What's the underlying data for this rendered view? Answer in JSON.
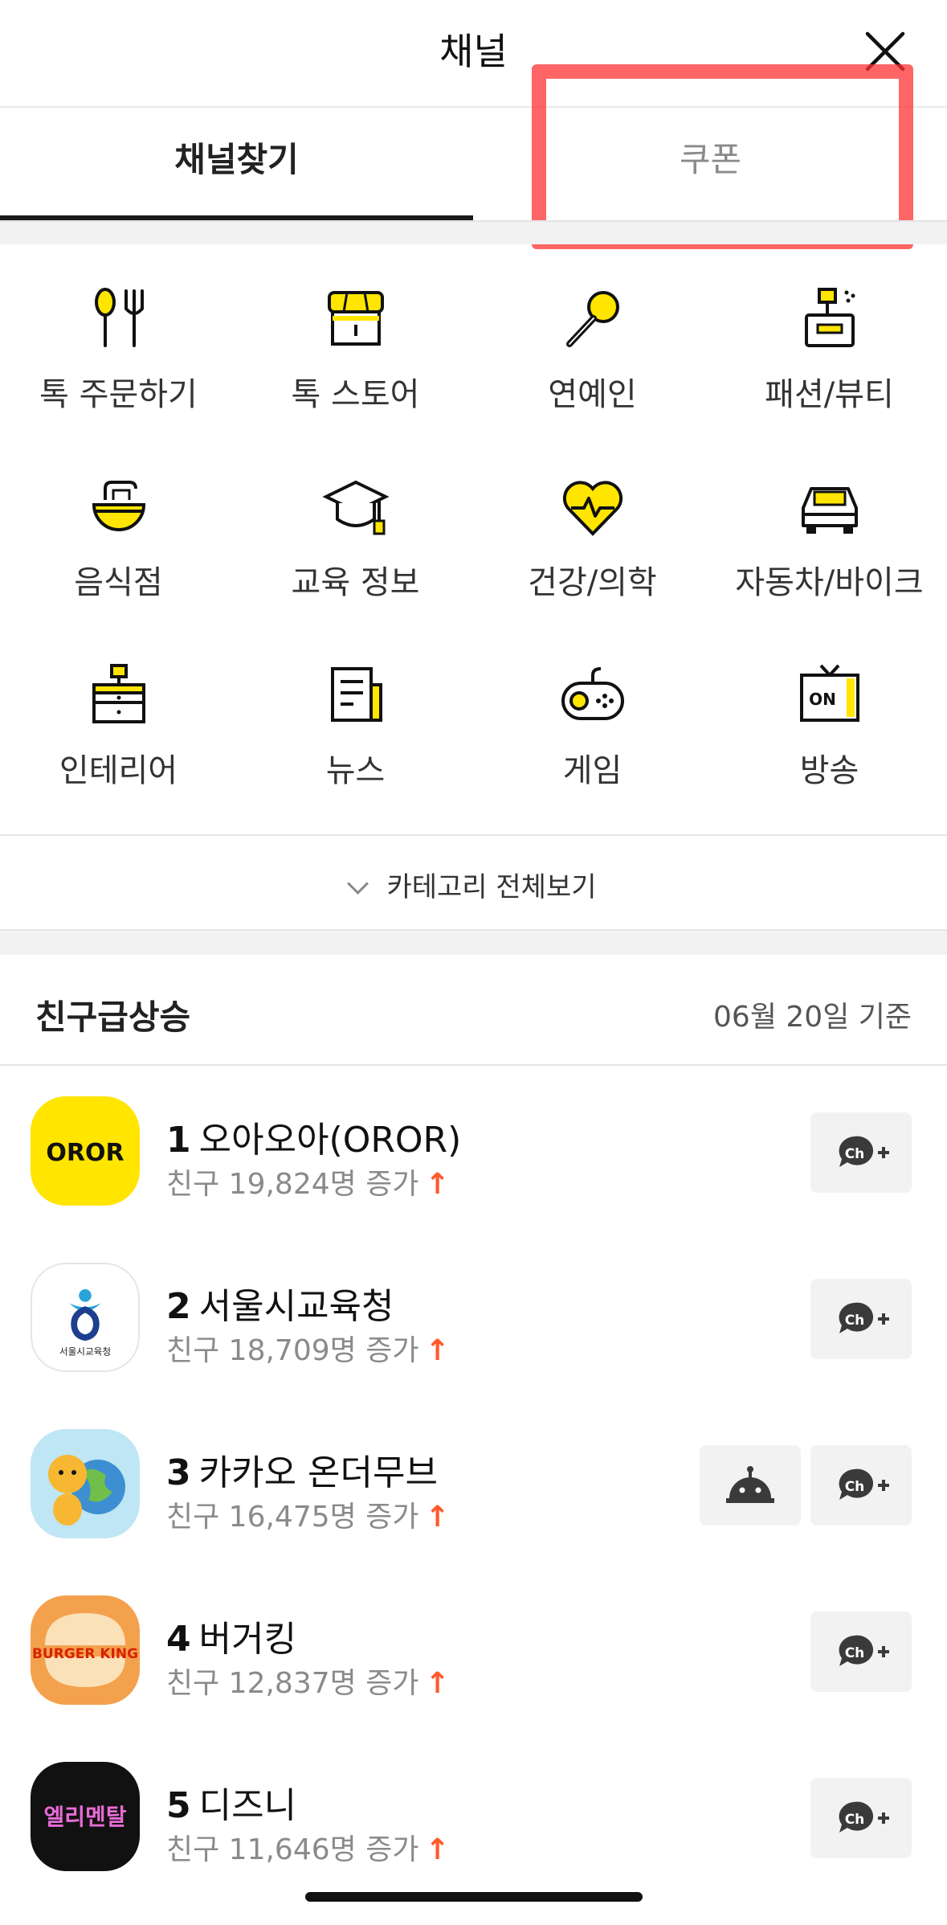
{
  "header": {
    "title": "채널"
  },
  "tabs": [
    {
      "label": "채널찾기"
    },
    {
      "label": "쿠폰"
    }
  ],
  "categories": [
    {
      "label": "톡 주문하기",
      "icon": "utensils-icon"
    },
    {
      "label": "톡 스토어",
      "icon": "store-icon"
    },
    {
      "label": "연예인",
      "icon": "microphone-icon"
    },
    {
      "label": "패션/뷰티",
      "icon": "vanity-icon"
    },
    {
      "label": "음식점",
      "icon": "bowl-icon"
    },
    {
      "label": "교육 정보",
      "icon": "graduation-cap-icon"
    },
    {
      "label": "건강/의학",
      "icon": "heart-pulse-icon"
    },
    {
      "label": "자동차/바이크",
      "icon": "car-icon"
    },
    {
      "label": "인테리어",
      "icon": "drawer-lamp-icon"
    },
    {
      "label": "뉴스",
      "icon": "newspaper-icon"
    },
    {
      "label": "게임",
      "icon": "gamepad-icon"
    },
    {
      "label": "방송",
      "icon": "tv-on-icon"
    }
  ],
  "more_categories": {
    "label": "카테고리 전체보기"
  },
  "ranking": {
    "title": "친구급상승",
    "date": "06월 20일 기준",
    "items": [
      {
        "rank": "1",
        "name": "오아오아(OROR)",
        "sub": "친구 19,824명 증가",
        "logo_text": "OROR",
        "has_bot": false
      },
      {
        "rank": "2",
        "name": "서울시교육청",
        "sub": "친구 18,709명 증가",
        "logo_text": "서울시교육청",
        "has_bot": false
      },
      {
        "rank": "3",
        "name": "카카오 온더무브",
        "sub": "친구 16,475명 증가",
        "logo_text": "",
        "has_bot": true
      },
      {
        "rank": "4",
        "name": "버거킹",
        "sub": "친구 12,837명 증가",
        "logo_text": "BURGER KING",
        "has_bot": false
      },
      {
        "rank": "5",
        "name": "디즈니",
        "sub": "친구 11,646명 증가",
        "logo_text": "엘리멘탈",
        "has_bot": false
      }
    ],
    "up_arrow": "↑",
    "add_button_label": "Ch+"
  },
  "colors": {
    "accent_yellow": "#FFE500",
    "up_arrow": "#FF5A2C",
    "highlight": "#FF3232"
  }
}
